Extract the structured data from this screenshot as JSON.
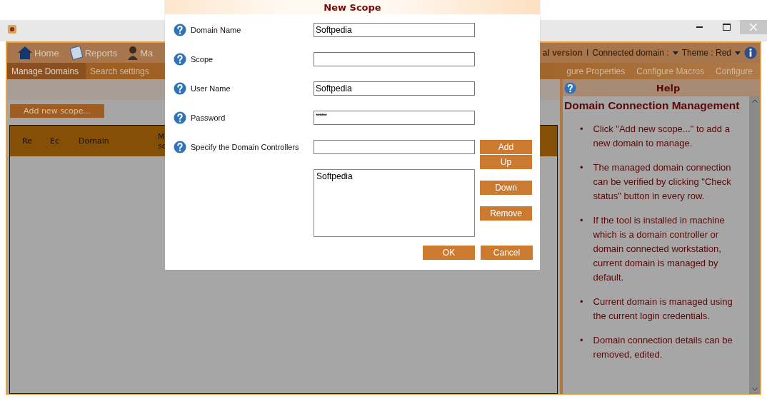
{
  "menu_bar": {
    "items": [
      {
        "label": "Home",
        "kind": "home"
      },
      {
        "label": "Reports",
        "kind": "reports"
      },
      {
        "label": "Ma",
        "kind": "user"
      }
    ],
    "trial": "al version",
    "separator": "I",
    "connected_domain": "Connected domain :",
    "theme": "Theme : Red"
  },
  "sub_tabs": [
    {
      "label": "Manage Domains",
      "selected": true
    },
    {
      "label": "Search settings",
      "selected": false
    },
    {
      "label": "gure Properties",
      "selected": false
    },
    {
      "label": "Configure Macros",
      "selected": false
    },
    {
      "label": "Configure",
      "selected": false
    }
  ],
  "add_scope_button": "Add new scope...",
  "table": {
    "columns": [
      "Re",
      "Ec",
      "Domain"
    ],
    "column_4": [
      "M",
      "sc"
    ]
  },
  "help": {
    "title": "Help",
    "bullet": "•",
    "heading": "Domain Connection Management",
    "items": [
      "Click \"Add new scope...\" to add a new domain to manage.",
      "The managed domain connection can be verified by clicking \"Check status\" button in every row.",
      "If the tool is installed in machine which is a domain controller or domain connected workstation, current domain is managed by default.",
      "Current domain is managed using the current login credentials.",
      "Domain connection details can be removed, edited."
    ]
  },
  "dialog": {
    "title": "New Scope",
    "fields": [
      {
        "label": "Domain Name",
        "value": "Softpedia",
        "kind": "text"
      },
      {
        "label": "Scope",
        "kind": "text"
      },
      {
        "label": "User Name",
        "value": "Softpedia",
        "kind": "text"
      },
      {
        "label": "Password",
        "value": "******",
        "kind": "password"
      },
      {
        "label": "Specify the Domain Controllers",
        "kind": "text"
      }
    ],
    "controllers": [
      "Softpedia"
    ],
    "side_buttons": [
      "Add",
      "Up",
      "Down",
      "Remove"
    ],
    "buttons": [
      "OK",
      "Cancel"
    ]
  }
}
